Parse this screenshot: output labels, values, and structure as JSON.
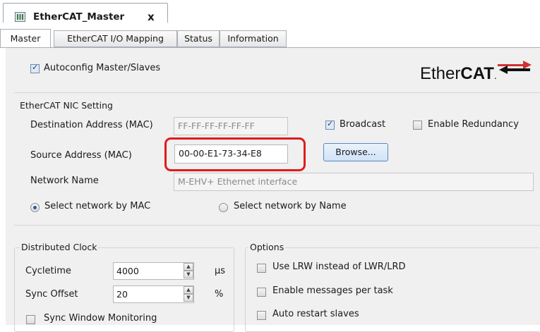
{
  "document_tab": {
    "title": "EtherCAT_Master",
    "close_glyph": "x",
    "icon": "device-icon"
  },
  "tabs": [
    {
      "label": "Master",
      "active": true
    },
    {
      "label": "EtherCAT I/O Mapping",
      "active": false
    },
    {
      "label": "Status",
      "active": false
    },
    {
      "label": "Information",
      "active": false
    }
  ],
  "autoconfig": {
    "label": "Autoconfig Master/Slaves",
    "checked": true
  },
  "logo": {
    "text_light": "Ether",
    "text_bold": "CAT",
    "mark": "."
  },
  "nic": {
    "section_title": "EtherCAT NIC Setting",
    "destination_label": "Destination Address (MAC)",
    "destination_value": "FF-FF-FF-FF-FF-FF",
    "broadcast_label": "Broadcast",
    "broadcast_checked": true,
    "redundancy_label": "Enable Redundancy",
    "redundancy_checked": false,
    "source_label": "Source Address (MAC)",
    "source_value": "00-00-E1-73-34-E8",
    "browse_label": "Browse...",
    "network_name_label": "Network Name",
    "network_name_value": "M-EHV+  Ethernet interface",
    "radio_mac_label": "Select network by MAC",
    "radio_mac_selected": true,
    "radio_name_label": "Select network by Name",
    "radio_name_selected": false
  },
  "distributed_clock": {
    "section_title": "Distributed Clock",
    "cycletime_label": "Cycletime",
    "cycletime_value": "4000",
    "cycletime_unit": "µs",
    "sync_offset_label": "Sync Offset",
    "sync_offset_value": "20",
    "sync_offset_unit": "%",
    "sync_window_label": "Sync Window Monitoring",
    "sync_window_checked": false
  },
  "options": {
    "section_title": "Options",
    "items": [
      {
        "label": "Use LRW instead of LWR/LRD",
        "checked": false
      },
      {
        "label": "Enable messages per task",
        "checked": false
      },
      {
        "label": "Auto restart slaves",
        "checked": false
      }
    ]
  },
  "colors": {
    "highlight": "#e01b1b",
    "logo_red": "#d32f2f",
    "accent_blue": "#5b86c1"
  }
}
